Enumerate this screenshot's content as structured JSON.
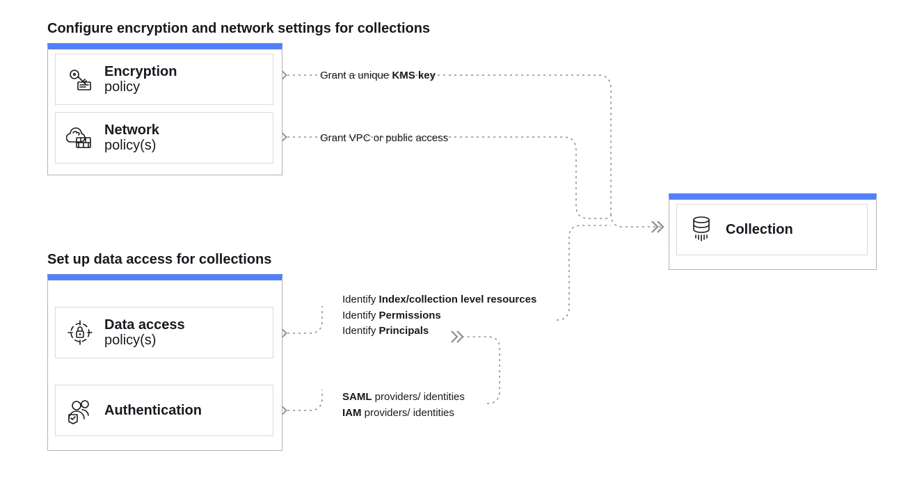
{
  "section1": {
    "title": "Configure encryption and network settings for collections"
  },
  "section2": {
    "title": "Set up data access for collections"
  },
  "cards": {
    "encryption": {
      "title": "Encryption",
      "sub": "policy"
    },
    "network": {
      "title": "Network",
      "sub": "policy(s)"
    },
    "dataAccess": {
      "title": "Data access",
      "sub": "policy(s)"
    },
    "auth": {
      "title": "Authentication",
      "sub": ""
    },
    "collection": {
      "title": "Collection",
      "sub": ""
    }
  },
  "notes": {
    "kms": {
      "pre": "Grant a unique ",
      "bold": "KMS key",
      "post": ""
    },
    "vpc": {
      "text": "Grant VPC or public access"
    },
    "idx": {
      "pre": "Identify ",
      "bold": "Index/collection level resources"
    },
    "perm": {
      "pre": "Identify ",
      "bold": "Permissions"
    },
    "princ": {
      "pre": "Identify ",
      "bold": "Principals"
    },
    "saml": {
      "bold": "SAML",
      "post": " providers/ identities"
    },
    "iam": {
      "bold": "IAM",
      "post": " providers/ identities"
    }
  },
  "colors": {
    "accent": "#527fff",
    "border": "#aab7b8",
    "card": "#d5dbdb",
    "dash": "#888f93"
  }
}
